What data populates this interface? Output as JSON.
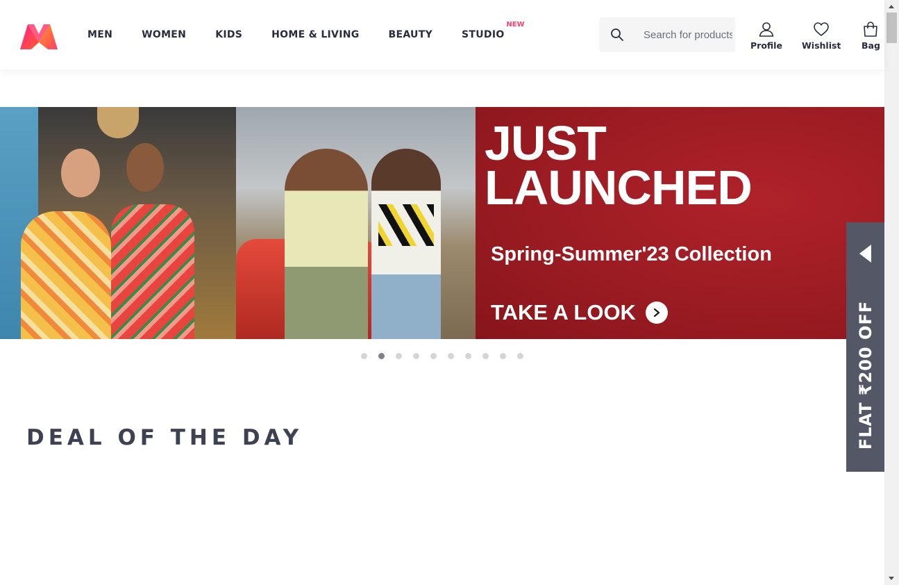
{
  "brand": {
    "logo_icon": "myntra-logo-icon",
    "colors": {
      "accent": "#ff3f6c",
      "text": "#282c3f",
      "promo_red": "#9e1c24",
      "offer_tab": "#535766"
    }
  },
  "nav": {
    "items": [
      {
        "label": "MEN"
      },
      {
        "label": "WOMEN"
      },
      {
        "label": "KIDS"
      },
      {
        "label": "HOME & LIVING"
      },
      {
        "label": "BEAUTY"
      },
      {
        "label": "STUDIO",
        "badge": "NEW"
      }
    ]
  },
  "search": {
    "placeholder": "Search for products, brands and more",
    "icon": "search-icon"
  },
  "actions": {
    "profile": {
      "label": "Profile",
      "icon": "user-icon"
    },
    "wishlist": {
      "label": "Wishlist",
      "icon": "heart-icon"
    },
    "bag": {
      "label": "Bag",
      "icon": "bag-icon"
    }
  },
  "banner": {
    "headline": "JUST\nLAUNCHED",
    "subtitle": "Spring-Summer'23 Collection",
    "cta": "TAKE A LOOK",
    "cta_icon": "chevron-right-icon",
    "slide_count": 10,
    "active_slide": 2
  },
  "offer_tab": {
    "text": "FLAT ₹200 OFF",
    "icon": "triangle-left-icon"
  },
  "sections": {
    "deal_of_the_day": "DEAL OF THE DAY"
  }
}
